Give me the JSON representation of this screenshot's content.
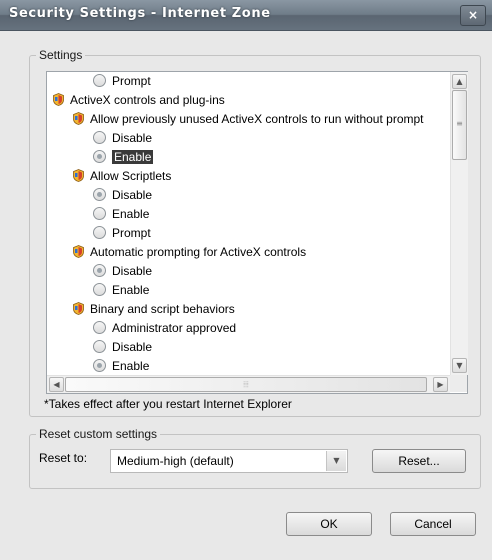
{
  "window": {
    "title": "Security Settings - Internet Zone",
    "close_label": "×"
  },
  "settings": {
    "legend": "Settings",
    "items": [
      {
        "type": "radio",
        "label": "Prompt",
        "checked": false,
        "indent": 2
      },
      {
        "type": "category",
        "label": "ActiveX controls and plug-ins",
        "indent": 0
      },
      {
        "type": "setting",
        "label": "Allow previously unused ActiveX controls to run without prompt",
        "indent": 1
      },
      {
        "type": "radio",
        "label": "Disable",
        "checked": false,
        "indent": 2
      },
      {
        "type": "radio",
        "label": "Enable",
        "checked": true,
        "selected": true,
        "indent": 2
      },
      {
        "type": "setting",
        "label": "Allow Scriptlets",
        "indent": 1
      },
      {
        "type": "radio",
        "label": "Disable",
        "checked": true,
        "indent": 2
      },
      {
        "type": "radio",
        "label": "Enable",
        "checked": false,
        "indent": 2
      },
      {
        "type": "radio",
        "label": "Prompt",
        "checked": false,
        "indent": 2
      },
      {
        "type": "setting",
        "label": "Automatic prompting for ActiveX controls",
        "indent": 1
      },
      {
        "type": "radio",
        "label": "Disable",
        "checked": true,
        "indent": 2
      },
      {
        "type": "radio",
        "label": "Enable",
        "checked": false,
        "indent": 2
      },
      {
        "type": "setting",
        "label": "Binary and script behaviors",
        "indent": 1
      },
      {
        "type": "radio",
        "label": "Administrator approved",
        "checked": false,
        "indent": 2
      },
      {
        "type": "radio",
        "label": "Disable",
        "checked": false,
        "indent": 2
      },
      {
        "type": "radio",
        "label": "Enable",
        "checked": true,
        "indent": 2
      }
    ],
    "note": "*Takes effect after you restart Internet Explorer"
  },
  "reset": {
    "legend": "Reset custom settings",
    "label": "Reset to:",
    "selected": "Medium-high (default)",
    "button": "Reset..."
  },
  "footer": {
    "ok": "OK",
    "cancel": "Cancel"
  },
  "colors": {
    "selection_bg": "#3a3a3a",
    "icon_shield": "#d6412b",
    "icon_gold": "#f1b530"
  }
}
